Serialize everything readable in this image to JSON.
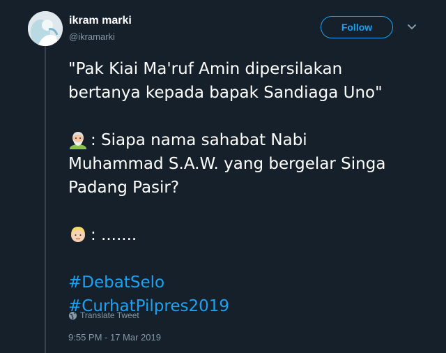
{
  "user": {
    "name": "ikram marki",
    "handle": "@ikramarki"
  },
  "follow_button": {
    "label": "Follow"
  },
  "tweet": {
    "line1": "\"Pak Kiai Ma'ruf Amin dipersilakan",
    "line2": "bertanya kepada bapak Sandiaga Uno\"",
    "question_prefix": ": Siapa nama sahabat Nabi",
    "question_line2": "Muhammad S.A.W. yang bergelar Singa",
    "question_line3": "Padang Pasir?",
    "answer": ": .......",
    "hashtags": [
      "#DebatSelo",
      "#CurhatPilpres2019"
    ]
  },
  "translate": {
    "label": "Translate Tweet",
    "icon": "globe-icon"
  },
  "timestamp": "9:55 PM - 17 Mar 2019",
  "icons": {
    "avatar": "avatar",
    "chevron": "chevron-down-icon",
    "emoji_old_man": "old-man-emoji-icon",
    "emoji_young_man": "young-man-emoji-icon"
  },
  "colors": {
    "background": "#15202b",
    "accent": "#1da1f2",
    "secondary_text": "#8899a6",
    "thread_line": "#38444d"
  }
}
